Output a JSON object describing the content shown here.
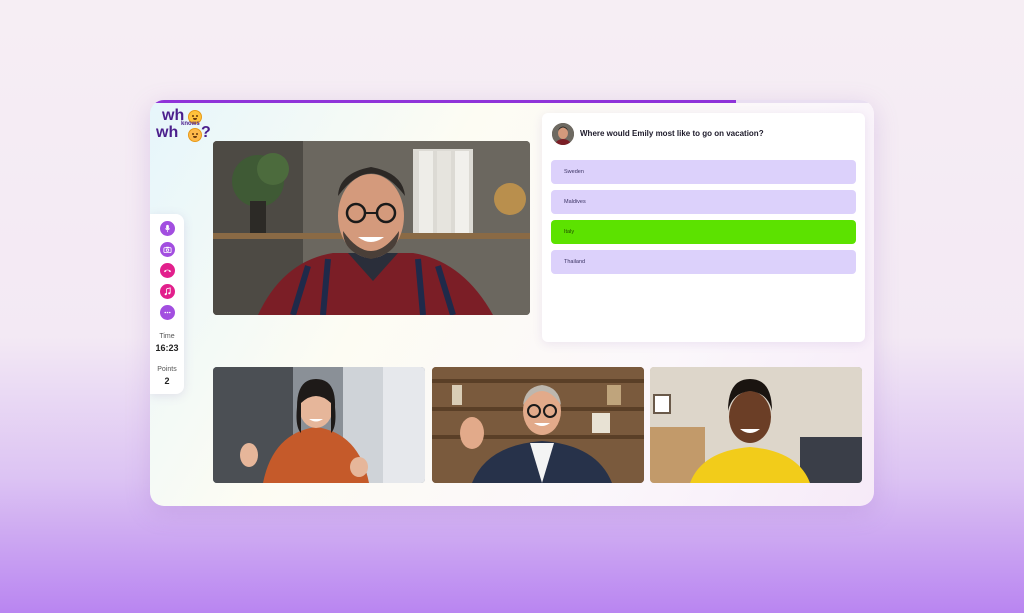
{
  "app": {
    "progress_percent": 81,
    "logo": {
      "line1": "wh",
      "small": "knows",
      "line2": "wh",
      "mark": "?"
    }
  },
  "sidebar": {
    "buttons": [
      {
        "name": "microphone-button",
        "icon": "microphone-icon",
        "color": "#a24ee0"
      },
      {
        "name": "camera-button",
        "icon": "camera-icon",
        "color": "#a24ee0"
      },
      {
        "name": "end-call-button",
        "icon": "phone-hangup-icon",
        "color": "#e2208c"
      },
      {
        "name": "music-button",
        "icon": "music-note-icon",
        "color": "#e2208c"
      },
      {
        "name": "more-button",
        "icon": "more-dots-icon",
        "color": "#a24ee0"
      }
    ],
    "time_label": "Time",
    "time_value": "16:23",
    "points_label": "Points",
    "points_value": "2"
  },
  "quiz": {
    "question": "Where would Emily most like to go on vacation?",
    "options": [
      {
        "label": "Sweden",
        "correct": false
      },
      {
        "label": "Maldives",
        "correct": false
      },
      {
        "label": "Italy",
        "correct": true
      },
      {
        "label": "Thailand",
        "correct": false
      }
    ]
  },
  "colors": {
    "accent_purple": "#8f34d9",
    "option_bg": "#dcd1fb",
    "correct_green": "#5ce200",
    "end_call_pink": "#e2208c"
  }
}
